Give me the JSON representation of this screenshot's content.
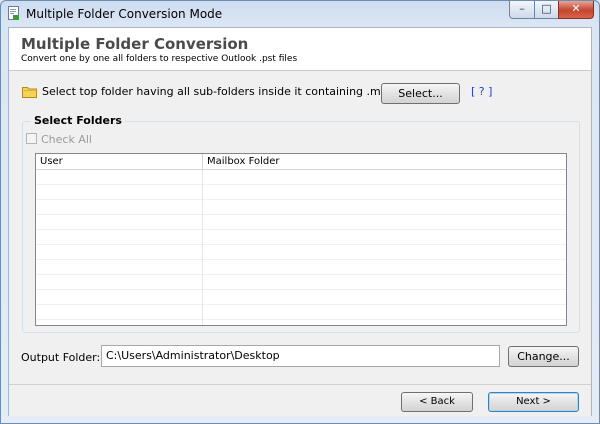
{
  "window": {
    "title": "Multiple Folder Conversion Mode",
    "controls": {
      "minimize": "–",
      "maximize": "□",
      "close": "✕"
    }
  },
  "header": {
    "title": "Multiple Folder Conversion",
    "subtitle": "Convert one by one all folders to respective Outlook .pst files"
  },
  "select_row": {
    "icon": "folder-icon",
    "instruction": "Select top folder having all sub-folders inside it containing .msg files",
    "select_button": "Select...",
    "help_link": "[ ? ]"
  },
  "folders_group": {
    "label": "Select Folders",
    "check_all_label": "Check All",
    "check_all_checked": false,
    "check_all_enabled": false,
    "columns": [
      "User",
      "Mailbox Folder"
    ],
    "rows": []
  },
  "output": {
    "label": "Output Folder:",
    "value": "C:\\Users\\Administrator\\Desktop",
    "change_button": "Change..."
  },
  "footer": {
    "back_button": "< Back",
    "next_button": "Next >"
  },
  "colors": {
    "header_title": "#4a4a4a",
    "help_link": "#1e40c8",
    "window_frame": "#cddcef",
    "close_button": "#c3452e"
  }
}
